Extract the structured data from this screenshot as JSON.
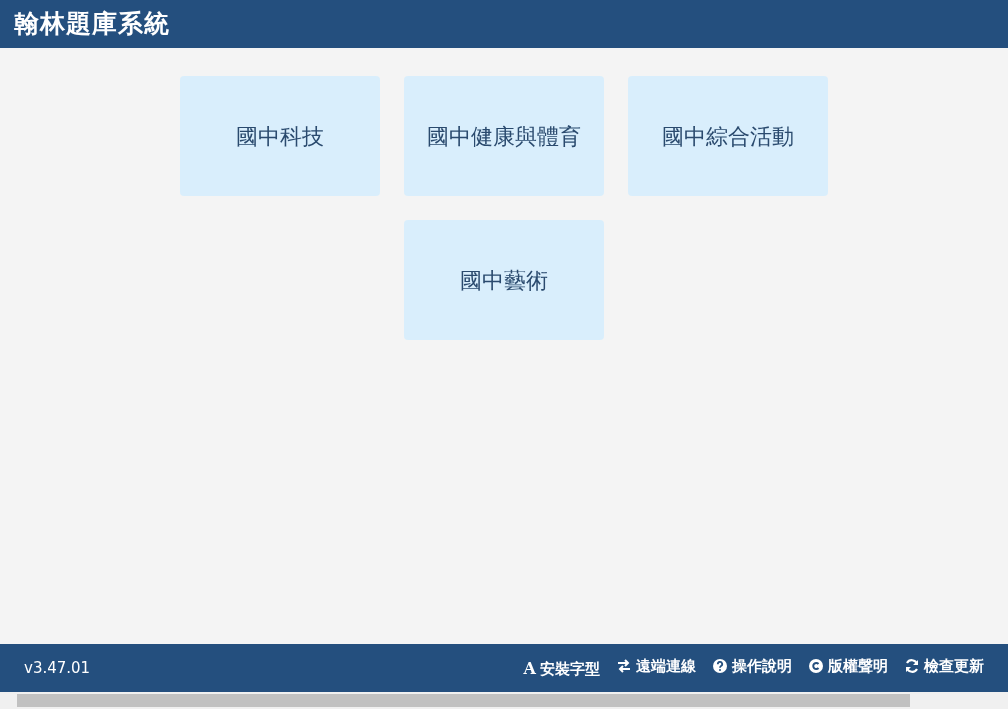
{
  "header": {
    "title": "翰林題庫系統"
  },
  "subjects": [
    {
      "label": "國中科技"
    },
    {
      "label": "國中健康與體育"
    },
    {
      "label": "國中綜合活動"
    },
    {
      "label": "國中藝術"
    }
  ],
  "footer": {
    "version": "v3.47.01",
    "links": [
      {
        "kind": "font",
        "glyph": "A",
        "label": "安裝字型"
      },
      {
        "kind": "remote",
        "label": "遠端連線"
      },
      {
        "kind": "help",
        "label": "操作說明"
      },
      {
        "kind": "copyright",
        "label": "版權聲明"
      },
      {
        "kind": "update",
        "label": "檢查更新"
      }
    ]
  }
}
